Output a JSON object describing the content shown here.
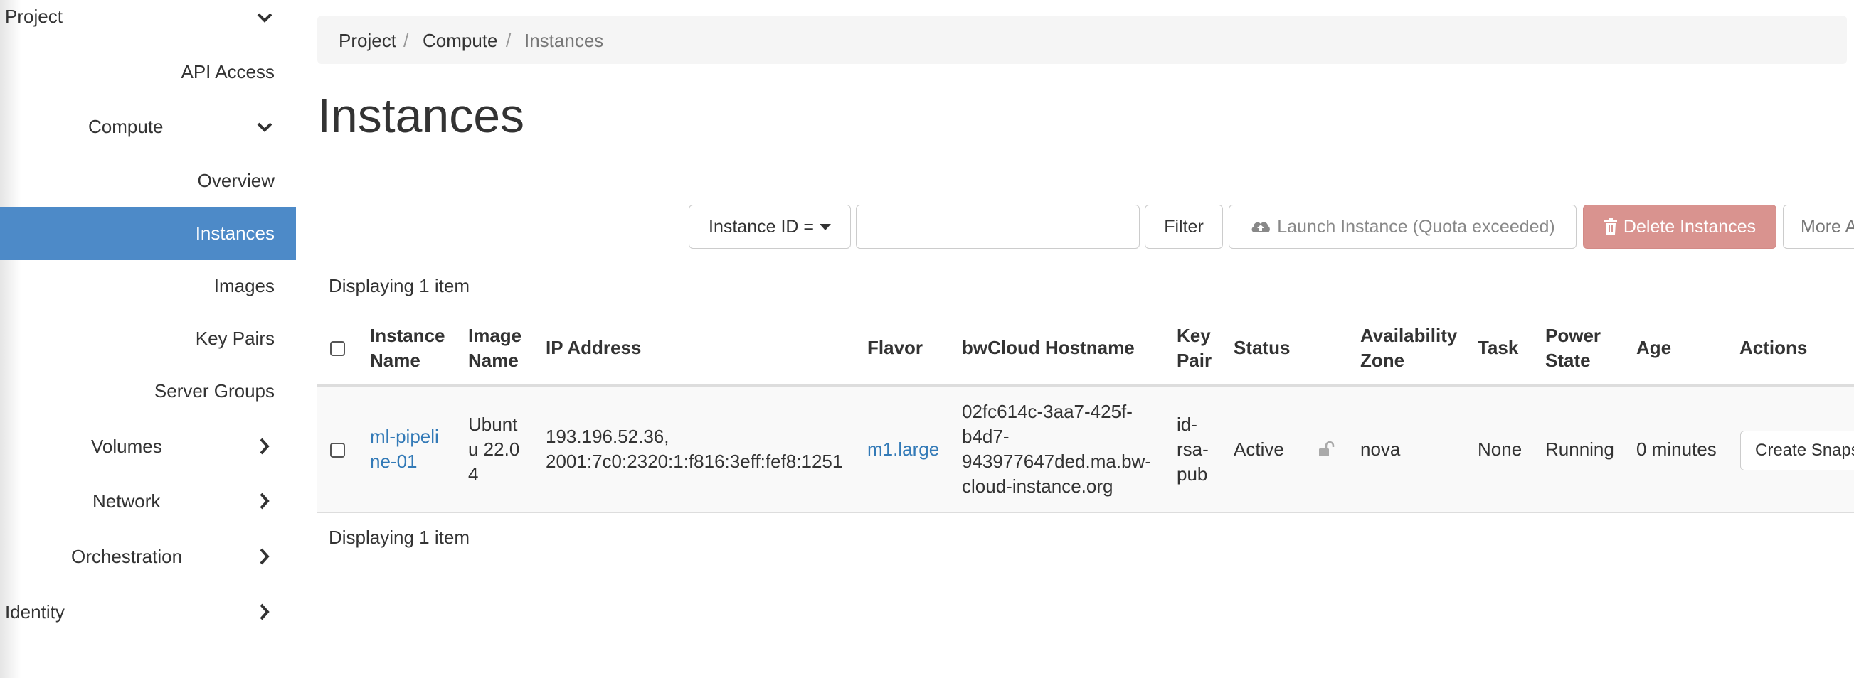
{
  "sidebar": {
    "project": "Project",
    "api_access": "API Access",
    "compute": "Compute",
    "overview": "Overview",
    "instances": "Instances",
    "images": "Images",
    "key_pairs": "Key Pairs",
    "server_groups": "Server Groups",
    "volumes": "Volumes",
    "network": "Network",
    "orchestration": "Orchestration",
    "identity": "Identity",
    "active_color": "#4d8ac8"
  },
  "breadcrumb": {
    "items": [
      "Project",
      "Compute",
      "Instances"
    ],
    "separator": "/"
  },
  "page": {
    "title": "Instances"
  },
  "toolbar": {
    "filter_field": "Instance ID =",
    "filter_value": "",
    "filter_button": "Filter",
    "launch_button": "Launch Instance (Quota exceeded)",
    "delete_button": "Delete Instances",
    "more_button": "More A",
    "danger_color": "#d9938f"
  },
  "table": {
    "displaying_top": "Displaying 1 item",
    "displaying_bottom": "Displaying 1 item",
    "headers": {
      "instance_name": [
        "Instance",
        "Name"
      ],
      "image_name": [
        "Image",
        "Name"
      ],
      "ip_address": "IP Address",
      "flavor": "Flavor",
      "hostname": "bwCloud Hostname",
      "key_pair": [
        "Key",
        "Pair"
      ],
      "status": "Status",
      "availability_zone": [
        "Availability",
        "Zone"
      ],
      "task": "Task",
      "power_state": [
        "Power",
        "State"
      ],
      "age": "Age",
      "actions": "Actions"
    },
    "rows": [
      {
        "instance_name": [
          "ml-pipeli",
          "ne-01"
        ],
        "image_name": [
          "Ubunt",
          "u 22.0",
          "4"
        ],
        "ip_address": [
          "193.196.52.36,",
          "2001:7c0:2320:1:f816:3eff:fef8:1251"
        ],
        "flavor": "m1.large",
        "hostname": [
          "02fc614c-3aa7-425f-",
          "b4d7-",
          "943977647ded.ma.bw-",
          "cloud-instance.org"
        ],
        "key_pair": [
          "id-",
          "rsa-",
          "pub"
        ],
        "status": "Active",
        "status_icon": "unlock-icon",
        "availability_zone": "nova",
        "task": "None",
        "power_state": "Running",
        "age": "0 minutes",
        "action_button": "Create Snaps"
      }
    ],
    "link_color": "#337ab7"
  }
}
